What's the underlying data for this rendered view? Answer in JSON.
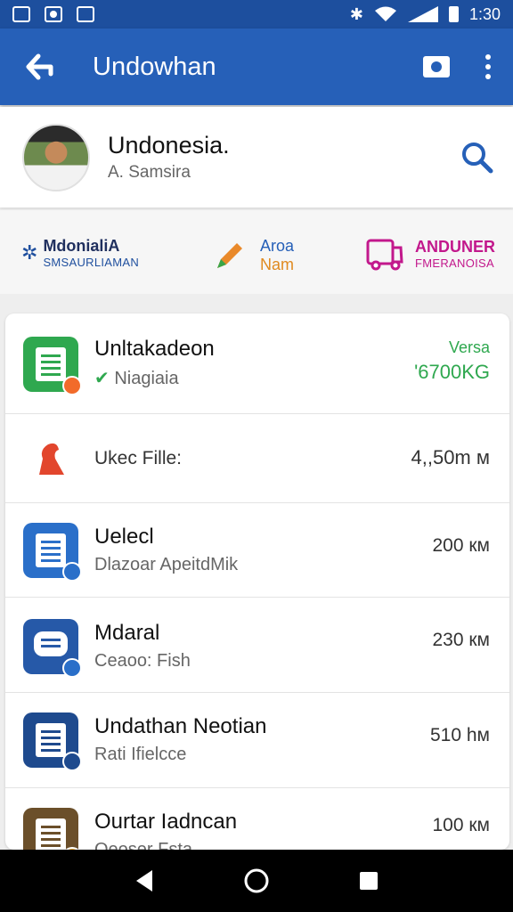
{
  "status_bar": {
    "time": "1:30"
  },
  "app_bar": {
    "title": "Undowhan"
  },
  "profile": {
    "name": "Undonesia.",
    "subtitle": "A. Samsira"
  },
  "quick_actions": [
    {
      "line1": "MdonialiA",
      "line2": "SMSAURLIAMAN",
      "color": "#1f4f9e"
    },
    {
      "line1": "Aroa",
      "line2": "Nam",
      "color1": "#2660b8",
      "color2": "#e08a1f"
    },
    {
      "line1": "ANDUNER",
      "line2": "FMERANOISA",
      "color": "#c2188c"
    }
  ],
  "list": {
    "items": [
      {
        "title": "Unltakadeon",
        "sub": "Niagiaia",
        "check": "✔",
        "right_top": "Versa",
        "right_bottom": "'6700KG",
        "icon_color": "#2fa84f",
        "badge_color": "#f26b2a"
      },
      {
        "title": "Ukec Fille:",
        "right": "4,,50m м",
        "icon_color": "#e2462d"
      },
      {
        "title": "Uelecl",
        "sub": "Dlazoar ApeitdMik",
        "right": "200 км",
        "icon_color": "#2a6fc9",
        "badge_color": "#2a6fc9"
      },
      {
        "title": "Mdaral",
        "sub": "Ceaoo: Fish",
        "right": "230 км",
        "icon_color": "#2659a8",
        "badge_color": "#2a6fc9"
      },
      {
        "title": "Undathan Neotian",
        "sub": "Rati Ifielcce",
        "right": "510 hм",
        "icon_color": "#1e4a8e",
        "badge_color": "#1e4a8e"
      },
      {
        "title": "Ourtar Iadncan",
        "sub": "Qeoser Fsta",
        "right": "100 км",
        "icon_color": "#6b4f2a",
        "badge_color": "#f0a52a"
      }
    ]
  }
}
